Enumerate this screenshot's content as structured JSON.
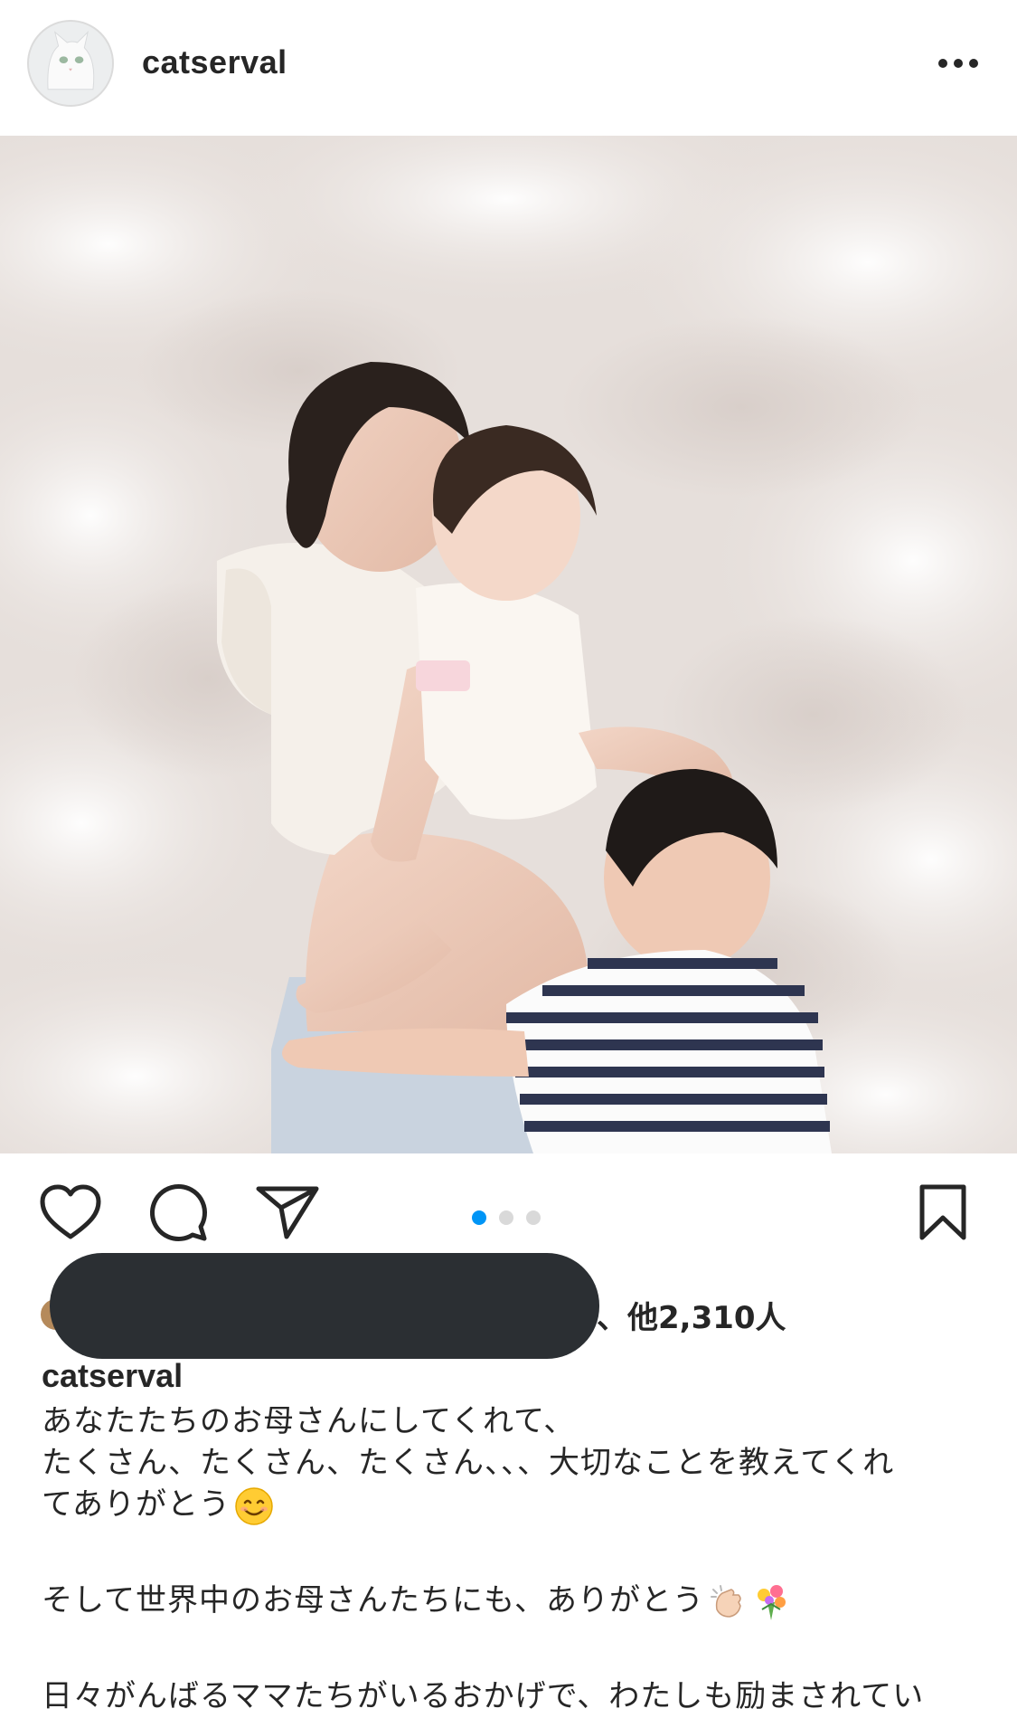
{
  "header": {
    "username": "catserval",
    "avatar_icon": "cat-avatar",
    "more_icon": "more-horizontal-icon"
  },
  "carousel": {
    "slide_count": 3,
    "active_index": 0,
    "active_color": "#0095f6",
    "inactive_color": "#d9d9d9"
  },
  "actions": {
    "like_icon": "heart-icon",
    "comment_icon": "comment-icon",
    "share_icon": "send-icon",
    "save_icon": "bookmark-icon"
  },
  "likes": {
    "suffix": "、他2,310人",
    "redacted": true,
    "redaction_color": "#2b2f33"
  },
  "caption": {
    "username": "catserval",
    "lines": [
      "あなたたちのお母さんにしてくれて、",
      "たくさん、たくさん、たくさん、、、大切なことを教えてくれ",
      "てありがとう",
      "そして世界中のお母さんたちにも、ありがとう",
      "日々がんばるママたちがいるおかげで、わたしも励まされてい"
    ],
    "emojis": {
      "line3": "smiling-face-emoji",
      "line4_a": "clapping-hands-emoji",
      "line4_b": "bouquet-emoji"
    }
  }
}
